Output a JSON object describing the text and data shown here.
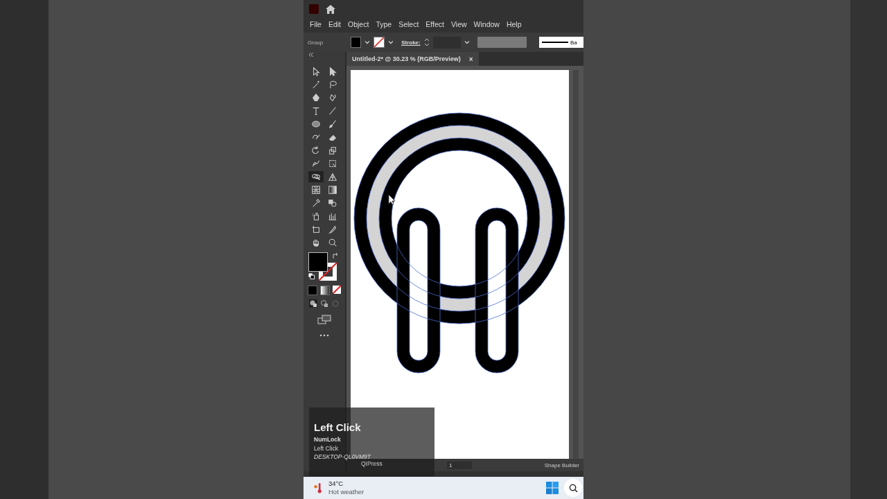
{
  "menu": [
    "File",
    "Edit",
    "Object",
    "Type",
    "Select",
    "Effect",
    "View",
    "Window",
    "Help"
  ],
  "control_bar": {
    "selection": "Group",
    "stroke_label": "Stroke:",
    "profile": "Ba"
  },
  "document_tab": {
    "title": "Untitled-2* @ 30.23 % (RGB/Preview)",
    "close": "×"
  },
  "tools": [
    {
      "selected": false
    },
    {
      "selected": false
    },
    {
      "selected": false
    },
    {
      "selected": false
    },
    {
      "selected": false
    },
    {
      "selected": false
    },
    {
      "selected": false
    },
    {
      "selected": false
    },
    {
      "selected": false
    },
    {
      "selected": false
    },
    {
      "selected": false
    },
    {
      "selected": false
    },
    {
      "selected": false
    },
    {
      "selected": false
    },
    {
      "selected": false
    },
    {
      "selected": false
    },
    {
      "selected": true
    },
    {
      "selected": false
    },
    {
      "selected": false
    },
    {
      "selected": false
    },
    {
      "selected": false
    },
    {
      "selected": false
    },
    {
      "selected": false
    },
    {
      "selected": false
    },
    {
      "selected": false
    },
    {
      "selected": false
    },
    {
      "selected": false
    },
    {
      "selected": false
    }
  ],
  "status_bar": {
    "artboard": "1",
    "tool": "Shape Builder"
  },
  "key_overlay": {
    "key": "Left Click",
    "lines": [
      "NumLock",
      "Left Click"
    ],
    "machine": "DESKTOP-QL0VM9T",
    "footer": "QIPress"
  },
  "taskbar": {
    "temperature": "34°C",
    "weather": "Hot weather"
  }
}
